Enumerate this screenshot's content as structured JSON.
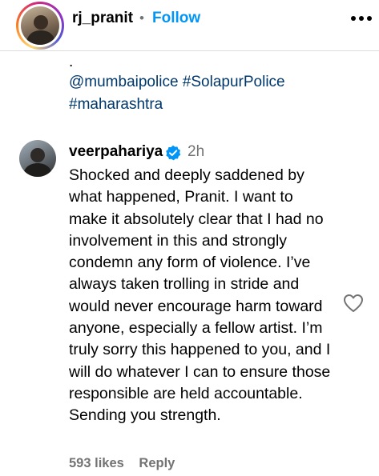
{
  "post_header": {
    "username": "rj_pranit",
    "separator": "•",
    "follow_label": "Follow",
    "more_icon": "more-horizontal-icon"
  },
  "caption": {
    "leading_text": ".",
    "hashtags": [
      "@mumbaipolice",
      "#SolapurPolice",
      "#maharashtra"
    ]
  },
  "comment": {
    "username": "veerpahariya",
    "verified_icon": "verified-badge-icon",
    "verified_color": "#0095f6",
    "time": "2h",
    "text": "Shocked and deeply saddened by what happened, Pranit. I want to make it absolutely clear that I had no involvement in this and strongly condemn any form of violence. I’ve always taken trolling in stride and would never encourage harm toward anyone, especially a fellow artist. I’m truly sorry this happened to you, and I will do whatever I can to ensure those responsible are held accountable. Sending you strength.",
    "likes": "593 likes",
    "reply_label": "Reply",
    "like_icon": "heart-outline-icon"
  },
  "colors": {
    "follow": "#0095f6",
    "link": "#00376b",
    "muted": "#737373",
    "divider": "#dbdbdb"
  }
}
